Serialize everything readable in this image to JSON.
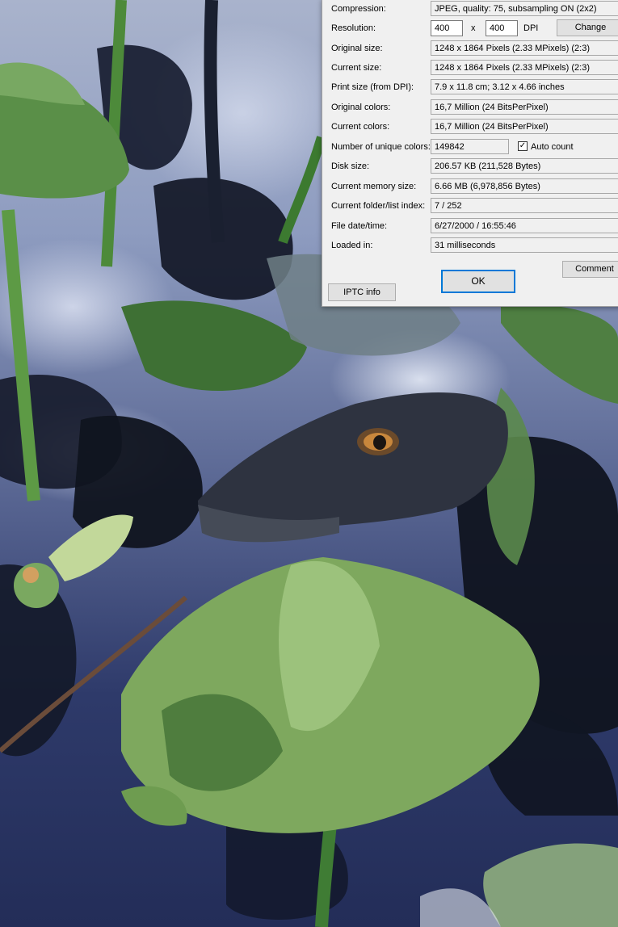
{
  "dialog": {
    "rows": [
      {
        "label": "Compression:",
        "value": "JPEG, quality: 75, subsampling ON (2x2)"
      },
      {
        "label": "Resolution:"
      },
      {
        "label": "Original size:",
        "value": "1248 x 1864  Pixels (2.33 MPixels) (2:3)"
      },
      {
        "label": "Current size:",
        "value": "1248 x 1864  Pixels (2.33 MPixels) (2:3)"
      },
      {
        "label": "Print size (from DPI):",
        "value": "7.9 x 11.8 cm; 3.12 x 4.66 inches"
      },
      {
        "label": "Original colors:",
        "value": "16,7 Million   (24 BitsPerPixel)"
      },
      {
        "label": "Current colors:",
        "value": "16,7 Million   (24 BitsPerPixel)"
      },
      {
        "label": "Number of unique colors:"
      },
      {
        "label": "Disk size:",
        "value": "206.57 KB (211,528 Bytes)"
      },
      {
        "label": "Current memory size:",
        "value": "6.66  MB (6,978,856 Bytes)"
      },
      {
        "label": "Current folder/list index:",
        "value": "7  /  252"
      },
      {
        "label": "File date/time:",
        "value": "6/27/2000 / 16:55:46"
      },
      {
        "label": "Loaded in:",
        "value": "31 milliseconds"
      }
    ],
    "resolution": {
      "x": "400",
      "separator": "x",
      "y": "400",
      "unit": "DPI",
      "change_label": "Change"
    },
    "unique_colors": {
      "value": "149842",
      "auto_count_label": "Auto count",
      "auto_count_checked": true
    },
    "buttons": {
      "comment": "Comment",
      "iptc": "IPTC info",
      "ok": "OK"
    }
  }
}
